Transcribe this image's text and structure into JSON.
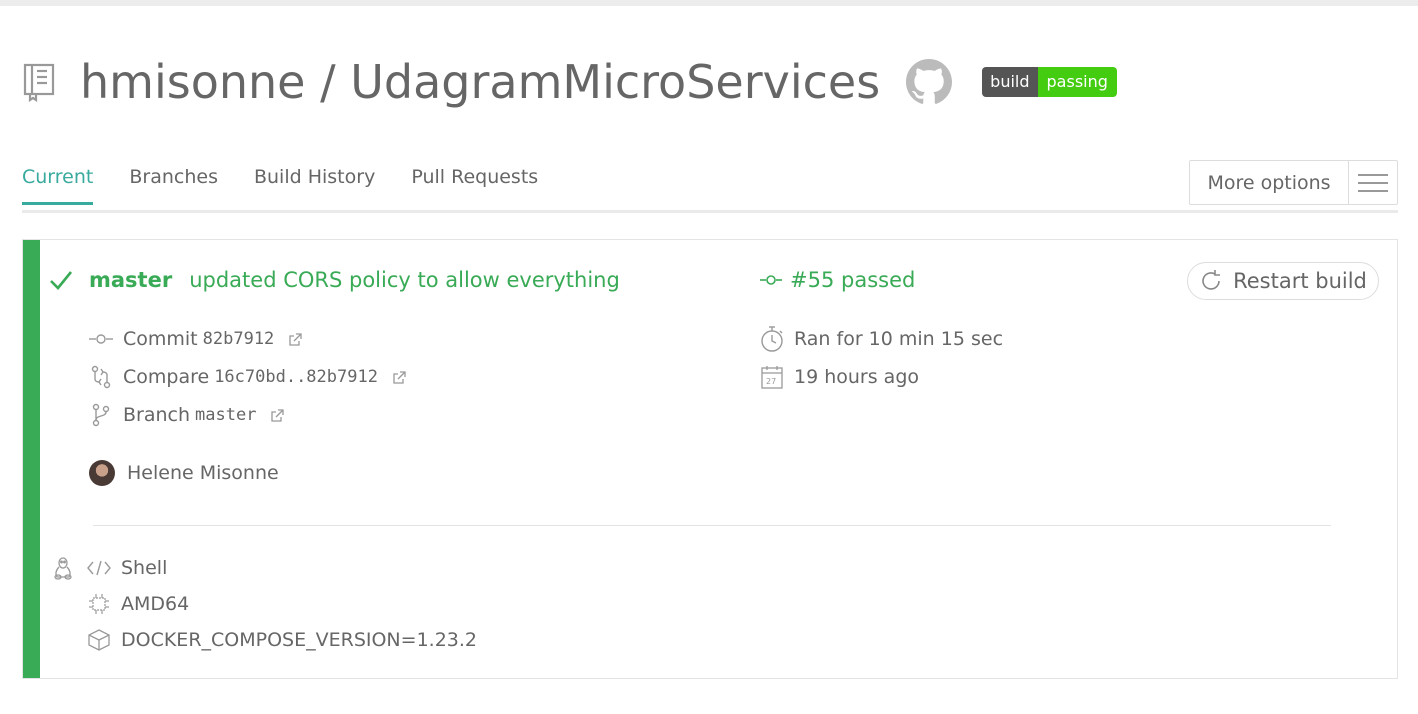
{
  "repo": {
    "owner": "hmisonne",
    "separator": "/",
    "name": "UdagramMicroServices",
    "badge_left": "build",
    "badge_right": "passing"
  },
  "tabs": [
    {
      "label": "Current"
    },
    {
      "label": "Branches"
    },
    {
      "label": "Build History"
    },
    {
      "label": "Pull Requests"
    }
  ],
  "more_options_label": "More options",
  "build": {
    "branch": "master",
    "message": "updated CORS policy to allow everything",
    "number": "#55 passed",
    "restart_label": "Restart build",
    "commit_label": "Commit",
    "commit_sha": "82b7912",
    "compare_label": "Compare",
    "compare_range": "16c70bd..82b7912",
    "branch_label": "Branch",
    "branch_name": "master",
    "author": "Helene Misonne",
    "duration": "Ran for 10 min 15 sec",
    "finished": "19 hours ago"
  },
  "job": {
    "language": "Shell",
    "arch": "AMD64",
    "env": "DOCKER_COMPOSE_VERSION=1.23.2"
  },
  "colors": {
    "accent": "#39aa9e",
    "passed": "#39aa56",
    "badge_pass": "#44cc11"
  },
  "icons": [
    "repo-icon",
    "github-icon",
    "checkmark-icon",
    "commit-icon",
    "compare-icon",
    "branch-icon",
    "external-link-icon",
    "stopwatch-icon",
    "calendar-icon",
    "restart-icon",
    "linux-icon",
    "code-icon",
    "cpu-icon",
    "box-icon",
    "hamburger-icon"
  ]
}
